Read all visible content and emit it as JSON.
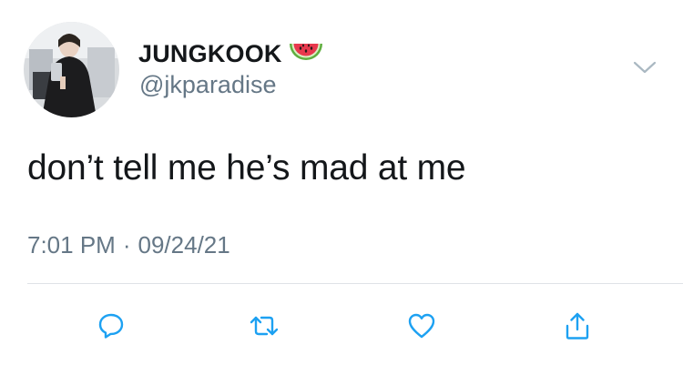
{
  "tweet": {
    "author": {
      "display_name": "JUNGKOOK",
      "name_emoji": "watermelon-emoji",
      "handle": "@jkparadise"
    },
    "text": "don’t tell me he’s mad at me",
    "time": "7:01 PM",
    "separator": "·",
    "date": "09/24/21"
  },
  "actions": [
    {
      "name": "reply",
      "icon": "reply-bubble-icon"
    },
    {
      "name": "retweet",
      "icon": "retweet-icon"
    },
    {
      "name": "like",
      "icon": "heart-icon"
    },
    {
      "name": "share",
      "icon": "share-icon"
    }
  ],
  "colors": {
    "text_primary": "#14171a",
    "text_secondary": "#657786",
    "icon": "#1da1f2",
    "divider": "#dfe3e7"
  }
}
